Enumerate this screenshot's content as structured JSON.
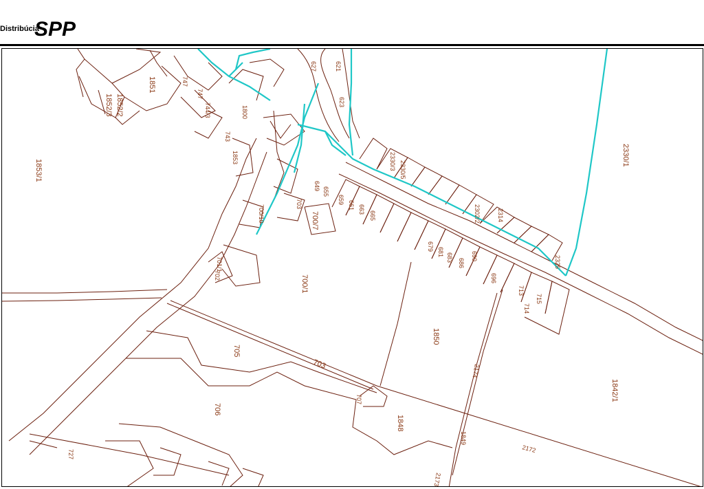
{
  "header": {
    "company_label": "Distribúcia",
    "logo_text": "SPP"
  },
  "colors": {
    "parcel_line": "#6b1f0e",
    "parcel_label": "#8b3a16",
    "gas_pipeline": "#1fc7c7"
  },
  "map": {
    "parcel_labels": [
      "1852/2",
      "1852/3",
      "1851",
      "1853/1",
      "627",
      "621",
      "623",
      "649",
      "655",
      "659",
      "661",
      "663",
      "665",
      "700/7",
      "700/1",
      "701/1",
      "702",
      "705",
      "703",
      "706",
      "707",
      "1850",
      "1848",
      "1849",
      "1842/1",
      "2330/1",
      "2174",
      "2172",
      "2173",
      "727",
      "743",
      "747",
      "744/3",
      "1800",
      "2330/3",
      "679",
      "681",
      "683",
      "686",
      "690",
      "696",
      "713",
      "715",
      "714",
      "2302/2",
      "2314",
      "2325",
      "700/10",
      "703",
      "1853",
      "2330/5",
      "747"
    ]
  }
}
